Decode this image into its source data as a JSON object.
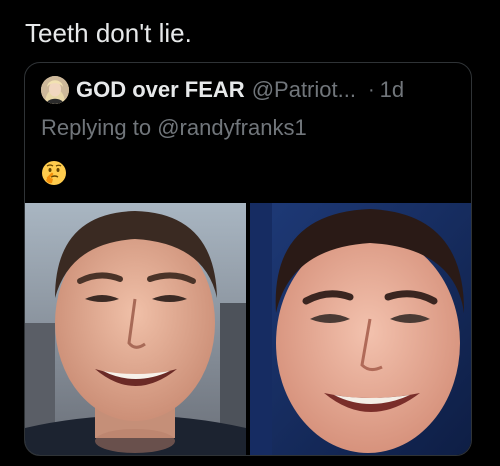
{
  "post": {
    "text": "Teeth don't lie."
  },
  "quoted": {
    "display_name": "GOD over FEAR",
    "handle": "@Patriot...",
    "separator": "·",
    "time": "1d",
    "reply_prefix": "Replying to",
    "reply_to": "@randyfranks1",
    "emoji": "🤔",
    "avatar_icon": "profile-avatar-icon",
    "media": [
      {
        "name": "photo-left",
        "subject": "smiling man, before"
      },
      {
        "name": "photo-right",
        "subject": "smiling man, after"
      }
    ]
  },
  "colors": {
    "background": "#000000",
    "text_primary": "#e7e9ea",
    "text_secondary": "#71767b",
    "border": "#2f3336"
  }
}
